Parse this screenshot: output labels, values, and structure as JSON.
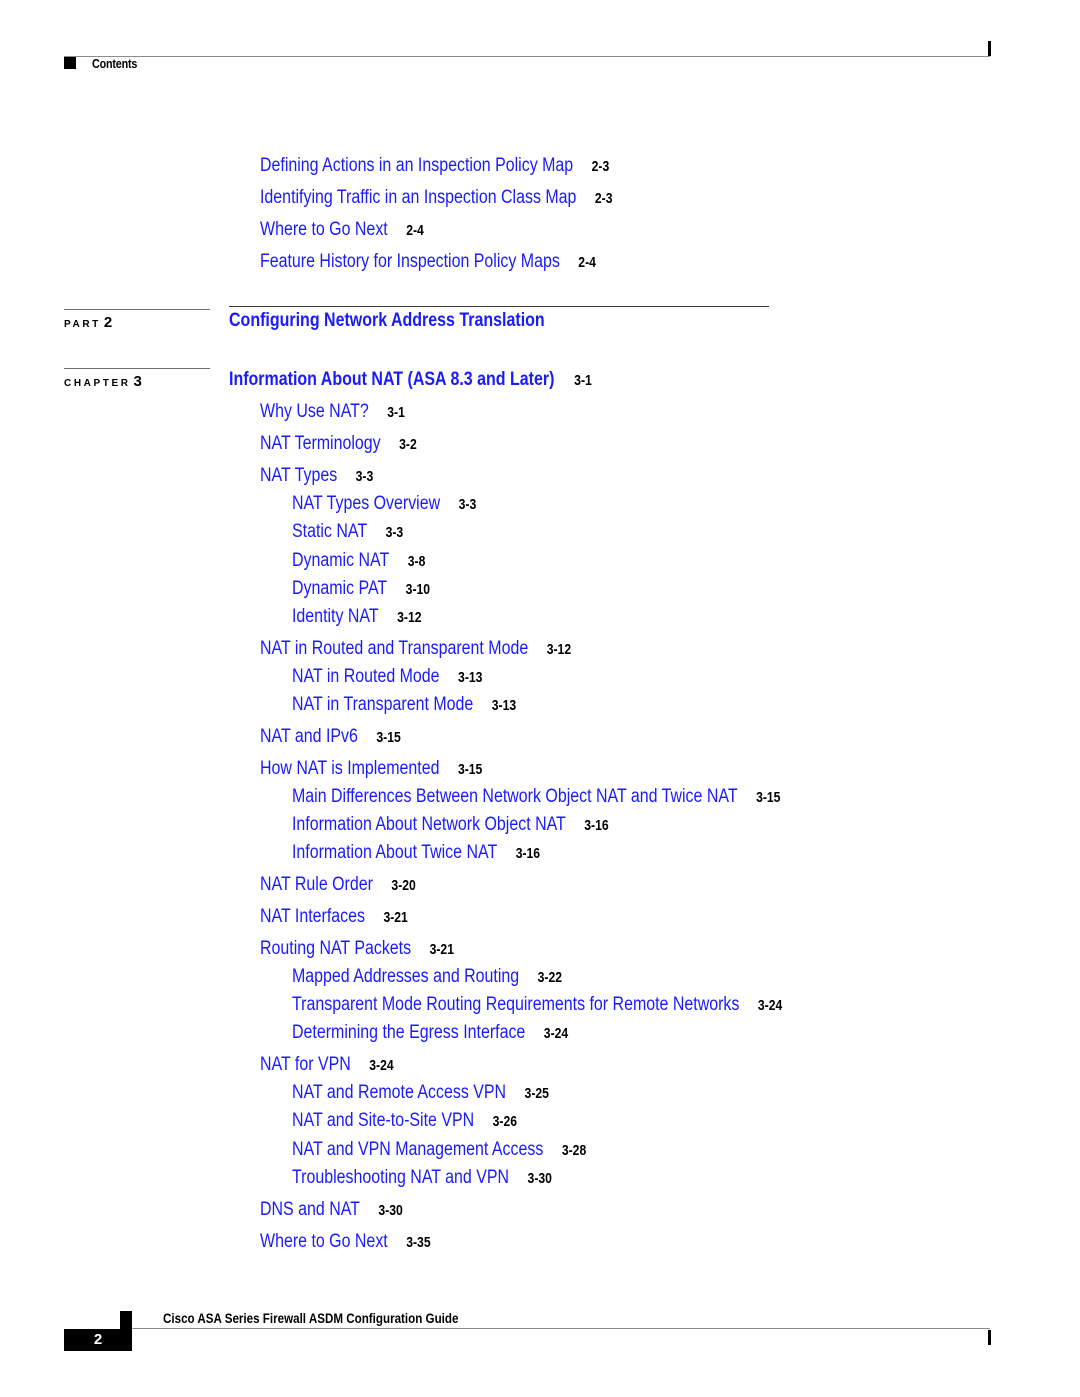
{
  "header": {
    "section_label": "Contents",
    "marker_icon": "black-square-icon"
  },
  "toc_top": [
    {
      "title": "Defining Actions in an Inspection Policy Map",
      "page": "2-3",
      "level": 1
    },
    {
      "title": "Identifying Traffic in an Inspection Class Map",
      "page": "2-3",
      "level": 1
    },
    {
      "title": "Where to Go Next",
      "page": "2-4",
      "level": 1
    },
    {
      "title": "Feature History for Inspection Policy Maps",
      "page": "2-4",
      "level": 1
    }
  ],
  "part": {
    "label": "PART",
    "number": "2",
    "title": "Configuring Network Address Translation"
  },
  "chapter": {
    "label": "CHAPTER",
    "number": "3",
    "title": "Information About NAT (ASA 8.3 and Later)",
    "page": "3-1"
  },
  "toc_chapter3": [
    {
      "title": "Why Use NAT?",
      "page": "3-1",
      "level": 1
    },
    {
      "title": "NAT Terminology",
      "page": "3-2",
      "level": 1
    },
    {
      "title": "NAT Types",
      "page": "3-3",
      "level": 1
    },
    {
      "title": "NAT Types Overview",
      "page": "3-3",
      "level": 2
    },
    {
      "title": "Static NAT",
      "page": "3-3",
      "level": 2
    },
    {
      "title": "Dynamic NAT",
      "page": "3-8",
      "level": 2
    },
    {
      "title": "Dynamic PAT",
      "page": "3-10",
      "level": 2
    },
    {
      "title": "Identity NAT",
      "page": "3-12",
      "level": 2
    },
    {
      "title": "NAT in Routed and Transparent Mode",
      "page": "3-12",
      "level": 1
    },
    {
      "title": "NAT in Routed Mode",
      "page": "3-13",
      "level": 2
    },
    {
      "title": "NAT in Transparent Mode",
      "page": "3-13",
      "level": 2
    },
    {
      "title": "NAT and IPv6",
      "page": "3-15",
      "level": 1
    },
    {
      "title": "How NAT is Implemented",
      "page": "3-15",
      "level": 1
    },
    {
      "title": "Main Differences Between Network Object NAT and Twice NAT",
      "page": "3-15",
      "level": 2
    },
    {
      "title": "Information About Network Object NAT",
      "page": "3-16",
      "level": 2
    },
    {
      "title": "Information About Twice NAT",
      "page": "3-16",
      "level": 2
    },
    {
      "title": "NAT Rule Order",
      "page": "3-20",
      "level": 1
    },
    {
      "title": "NAT Interfaces",
      "page": "3-21",
      "level": 1
    },
    {
      "title": "Routing NAT Packets",
      "page": "3-21",
      "level": 1
    },
    {
      "title": "Mapped Addresses and Routing",
      "page": "3-22",
      "level": 2
    },
    {
      "title": "Transparent Mode Routing Requirements for Remote Networks",
      "page": "3-24",
      "level": 2
    },
    {
      "title": "Determining the Egress Interface",
      "page": "3-24",
      "level": 2
    },
    {
      "title": "NAT for VPN",
      "page": "3-24",
      "level": 1
    },
    {
      "title": "NAT and Remote Access VPN",
      "page": "3-25",
      "level": 2
    },
    {
      "title": "NAT and Site-to-Site VPN",
      "page": "3-26",
      "level": 2
    },
    {
      "title": "NAT and VPN Management Access",
      "page": "3-28",
      "level": 2
    },
    {
      "title": "Troubleshooting NAT and VPN",
      "page": "3-30",
      "level": 2
    },
    {
      "title": "DNS and NAT",
      "page": "3-30",
      "level": 1
    },
    {
      "title": "Where to Go Next",
      "page": "3-35",
      "level": 1
    }
  ],
  "footer": {
    "book_title": "Cisco ASA Series Firewall ASDM Configuration Guide",
    "page_number": "2"
  },
  "colors": {
    "link": "#1a1aff",
    "page_ref": "#000000",
    "rule": "#8c8c8c"
  }
}
